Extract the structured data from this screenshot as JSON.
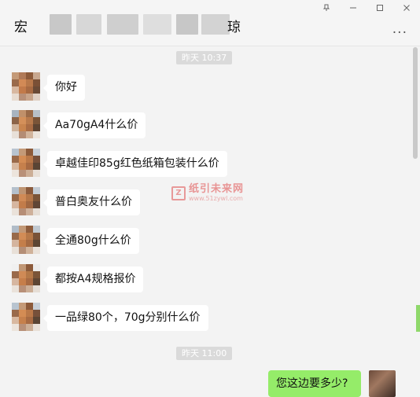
{
  "window": {
    "title_prefix": "宏",
    "title_visible_suffix": "琼",
    "pin_icon": "pin-icon",
    "min_icon": "minimize-icon",
    "max_icon": "maximize-icon",
    "close_icon": "close-icon",
    "more_label": "···"
  },
  "timestamps": [
    "昨天 10:37",
    "昨天 11:00"
  ],
  "messages": [
    {
      "text": "你好"
    },
    {
      "text": "Aa70gA4什么价"
    },
    {
      "text": "卓越佳印85g红色纸箱包装什么价"
    },
    {
      "text": "普白奥友什么价"
    },
    {
      "text": "全通80g什么价"
    },
    {
      "text": "都按A4规格报价"
    },
    {
      "text": "一品绿80个，70g分别什么价"
    }
  ],
  "watermark": {
    "logo_glyph": "Z",
    "name": "纸引未来网",
    "url": "www.51zywl.com"
  },
  "self_message": {
    "text": "您这边要多少?"
  },
  "colors": {
    "background": "#f3f3f3",
    "incoming_bubble": "#ffffff",
    "outgoing_bubble": "#95ec69",
    "time_pill": "#dadada",
    "watermark_red": "#e04848"
  }
}
